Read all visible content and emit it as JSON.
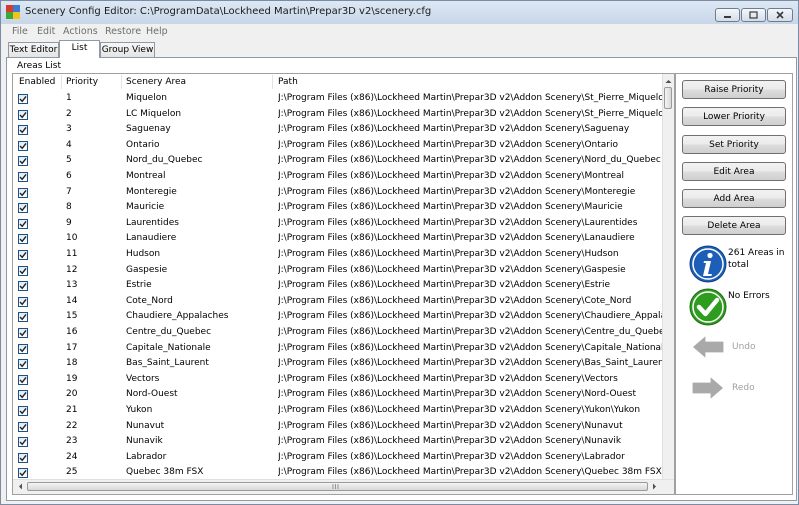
{
  "window": {
    "title": "Scenery Config Editor: C:\\ProgramData\\Lockheed Martin\\Prepar3D v2\\scenery.cfg"
  },
  "menu": [
    "File",
    "Edit",
    "Actions",
    "Restore",
    "Help"
  ],
  "tabs": [
    "Text Editor",
    "List",
    "Group View"
  ],
  "active_tab": "List",
  "areas_list": {
    "group_label": "Areas List",
    "columns": [
      "Enabled",
      "Priority",
      "Scenery Area",
      "Path"
    ],
    "rows": [
      {
        "enabled": true,
        "priority": "1",
        "area": "Miquelon",
        "path": "J:\\Program Files (x86)\\Lockheed Martin\\Prepar3D v2\\Addon Scenery\\St_Pierre_Miquelon\\Miqu"
      },
      {
        "enabled": true,
        "priority": "2",
        "area": "LC Miquelon",
        "path": "J:\\Program Files (x86)\\Lockheed Martin\\Prepar3D v2\\Addon Scenery\\St_Pierre_Miquelon\\LC M"
      },
      {
        "enabled": true,
        "priority": "3",
        "area": "Saguenay",
        "path": "J:\\Program Files (x86)\\Lockheed Martin\\Prepar3D v2\\Addon Scenery\\Saguenay"
      },
      {
        "enabled": true,
        "priority": "4",
        "area": "Ontario",
        "path": "J:\\Program Files (x86)\\Lockheed Martin\\Prepar3D v2\\Addon Scenery\\Ontario"
      },
      {
        "enabled": true,
        "priority": "5",
        "area": "Nord_du_Quebec",
        "path": "J:\\Program Files (x86)\\Lockheed Martin\\Prepar3D v2\\Addon Scenery\\Nord_du_Quebec"
      },
      {
        "enabled": true,
        "priority": "6",
        "area": "Montreal",
        "path": "J:\\Program Files (x86)\\Lockheed Martin\\Prepar3D v2\\Addon Scenery\\Montreal"
      },
      {
        "enabled": true,
        "priority": "7",
        "area": "Monteregie",
        "path": "J:\\Program Files (x86)\\Lockheed Martin\\Prepar3D v2\\Addon Scenery\\Monteregie"
      },
      {
        "enabled": true,
        "priority": "8",
        "area": "Mauricie",
        "path": "J:\\Program Files (x86)\\Lockheed Martin\\Prepar3D v2\\Addon Scenery\\Mauricie"
      },
      {
        "enabled": true,
        "priority": "9",
        "area": "Laurentides",
        "path": "J:\\Program Files (x86)\\Lockheed Martin\\Prepar3D v2\\Addon Scenery\\Laurentides"
      },
      {
        "enabled": true,
        "priority": "10",
        "area": "Lanaudiere",
        "path": "J:\\Program Files (x86)\\Lockheed Martin\\Prepar3D v2\\Addon Scenery\\Lanaudiere"
      },
      {
        "enabled": true,
        "priority": "11",
        "area": "Hudson",
        "path": "J:\\Program Files (x86)\\Lockheed Martin\\Prepar3D v2\\Addon Scenery\\Hudson"
      },
      {
        "enabled": true,
        "priority": "12",
        "area": "Gaspesie",
        "path": "J:\\Program Files (x86)\\Lockheed Martin\\Prepar3D v2\\Addon Scenery\\Gaspesie"
      },
      {
        "enabled": true,
        "priority": "13",
        "area": "Estrie",
        "path": "J:\\Program Files (x86)\\Lockheed Martin\\Prepar3D v2\\Addon Scenery\\Estrie"
      },
      {
        "enabled": true,
        "priority": "14",
        "area": "Cote_Nord",
        "path": "J:\\Program Files (x86)\\Lockheed Martin\\Prepar3D v2\\Addon Scenery\\Cote_Nord"
      },
      {
        "enabled": true,
        "priority": "15",
        "area": "Chaudiere_Appalaches",
        "path": "J:\\Program Files (x86)\\Lockheed Martin\\Prepar3D v2\\Addon Scenery\\Chaudiere_Appalaches"
      },
      {
        "enabled": true,
        "priority": "16",
        "area": "Centre_du_Quebec",
        "path": "J:\\Program Files (x86)\\Lockheed Martin\\Prepar3D v2\\Addon Scenery\\Centre_du_Quebec"
      },
      {
        "enabled": true,
        "priority": "17",
        "area": "Capitale_Nationale",
        "path": "J:\\Program Files (x86)\\Lockheed Martin\\Prepar3D v2\\Addon Scenery\\Capitale_Nationale"
      },
      {
        "enabled": true,
        "priority": "18",
        "area": "Bas_Saint_Laurent",
        "path": "J:\\Program Files (x86)\\Lockheed Martin\\Prepar3D v2\\Addon Scenery\\Bas_Saint_Laurent"
      },
      {
        "enabled": true,
        "priority": "19",
        "area": "Vectors",
        "path": "J:\\Program Files (x86)\\Lockheed Martin\\Prepar3D v2\\Addon Scenery\\Vectors"
      },
      {
        "enabled": true,
        "priority": "20",
        "area": "Nord-Ouest",
        "path": "J:\\Program Files (x86)\\Lockheed Martin\\Prepar3D v2\\Addon Scenery\\Nord-Ouest"
      },
      {
        "enabled": true,
        "priority": "21",
        "area": "Yukon",
        "path": "J:\\Program Files (x86)\\Lockheed Martin\\Prepar3D v2\\Addon Scenery\\Yukon\\Yukon"
      },
      {
        "enabled": true,
        "priority": "22",
        "area": "Nunavut",
        "path": "J:\\Program Files (x86)\\Lockheed Martin\\Prepar3D v2\\Addon Scenery\\Nunavut"
      },
      {
        "enabled": true,
        "priority": "23",
        "area": "Nunavik",
        "path": "J:\\Program Files (x86)\\Lockheed Martin\\Prepar3D v2\\Addon Scenery\\Nunavik"
      },
      {
        "enabled": true,
        "priority": "24",
        "area": "Labrador",
        "path": "J:\\Program Files (x86)\\Lockheed Martin\\Prepar3D v2\\Addon Scenery\\Labrador"
      },
      {
        "enabled": true,
        "priority": "25",
        "area": "Quebec 38m FSX",
        "path": "J:\\Program Files (x86)\\Lockheed Martin\\Prepar3D v2\\Addon Scenery\\Quebec 38m FSX"
      }
    ]
  },
  "buttons": [
    "Raise Priority",
    "Lower Priority",
    "Set Priority",
    "Edit Area",
    "Add Area",
    "Delete Area"
  ],
  "status": {
    "areas_line1": "261 Areas in",
    "areas_line2": "total",
    "errors": "No Errors",
    "undo": "Undo",
    "redo": "Redo"
  },
  "colors": {
    "info_blue": "#1d5fb8",
    "ok_green": "#2e9d1f",
    "disabled_gray": "#a0a0a0"
  }
}
